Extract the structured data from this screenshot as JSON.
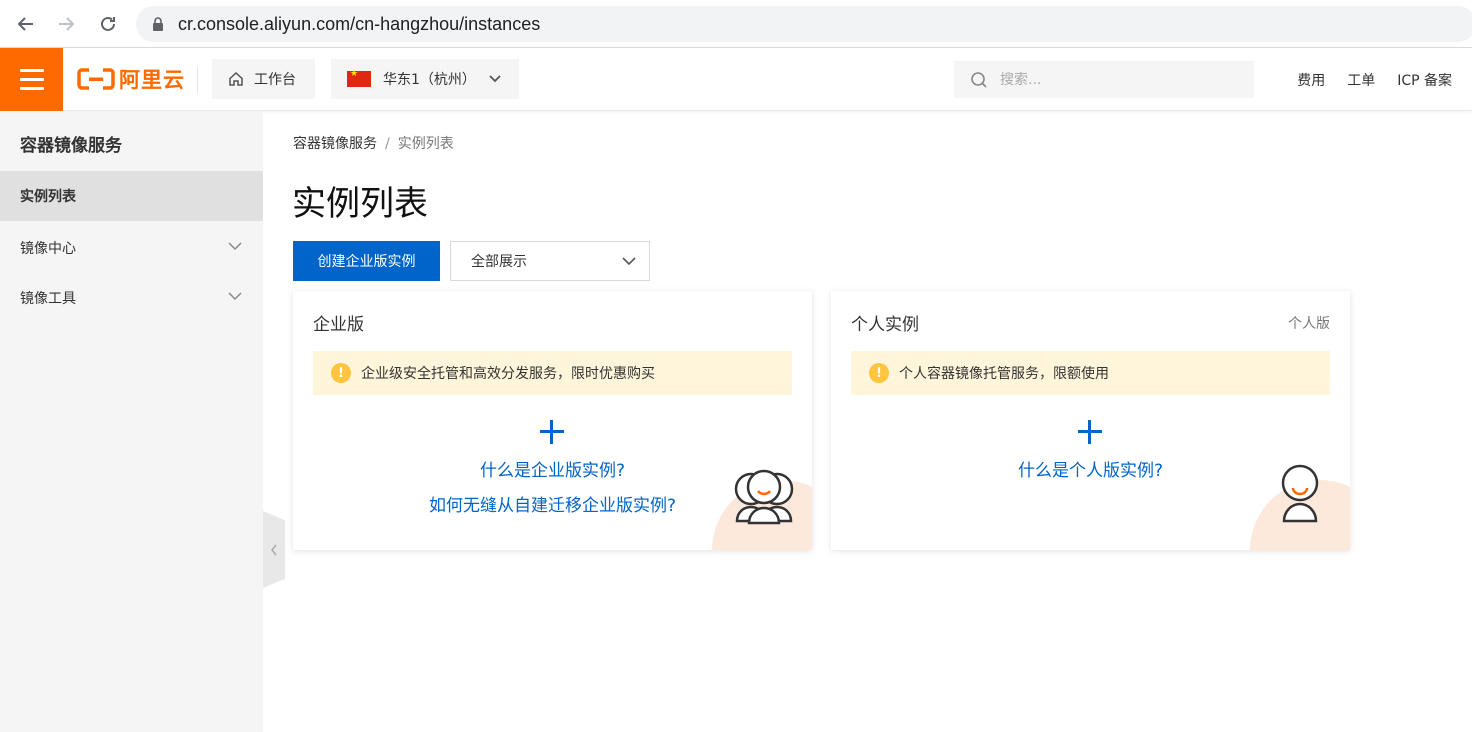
{
  "browser": {
    "url": "cr.console.aliyun.com/cn-hangzhou/instances"
  },
  "topbar": {
    "logo_text": "阿里云",
    "workbench_label": "工作台",
    "region_label": "华东1（杭州）",
    "search_placeholder": "搜索...",
    "links": [
      "费用",
      "工单",
      "ICP 备案"
    ]
  },
  "sidebar": {
    "title": "容器镜像服务",
    "items": [
      {
        "label": "实例列表",
        "active": true
      },
      {
        "label": "镜像中心",
        "expandable": true
      },
      {
        "label": "镜像工具",
        "expandable": true
      }
    ]
  },
  "main": {
    "breadcrumb": [
      "容器镜像服务",
      "实例列表"
    ],
    "title": "实例列表",
    "create_button": "创建企业版实例",
    "filter_select": "全部展示",
    "cards": [
      {
        "title": "企业版",
        "tag": "",
        "notice": "企业级安全托管和高效分发服务，限时优惠购买",
        "links": [
          "什么是企业版实例?",
          "如何无缝从自建迁移企业版实例?"
        ]
      },
      {
        "title": "个人实例",
        "tag": "个人版",
        "notice": "个人容器镜像托管服务，限额使用",
        "links": [
          "什么是个人版实例?"
        ]
      }
    ]
  },
  "colors": {
    "brand": "#ff6a00",
    "primary": "#0064c8",
    "notice_bg": "#fff5db"
  }
}
